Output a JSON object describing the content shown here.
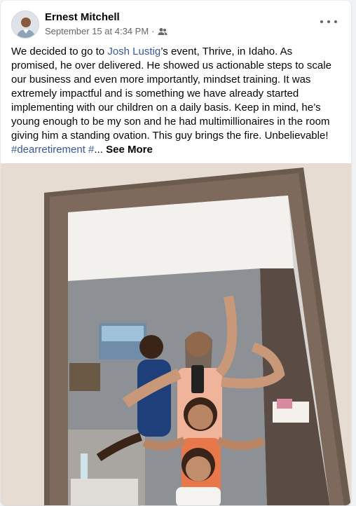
{
  "post": {
    "author": "Ernest Mitchell",
    "timestamp": "September 15 at 4:34 PM",
    "separator": "·",
    "audience_icon": "friends-icon",
    "more_icon": "more-options-icon",
    "text_intro": "We decided to go to ",
    "mention": "Josh Lustig",
    "text_body": "’s event, Thrive, in Idaho. As promised, he over delivered.  He showed us actionable steps to scale our business and even more importantly, mindset training. It was extremely impactful and is something we have already started implementing with our children on a daily basis. Keep in mind, he’s young enough to be my son and he had multimillionaires in the room giving him a standing ovation. This guy brings the fire. Unbelievable! ",
    "hashtag": "#dearretirement #",
    "ellipsis": "...",
    "see_more": "See More",
    "photo_description_icon": "post-photo"
  },
  "colors": {
    "link": "#385898",
    "meta": "#65676b",
    "text": "#050505"
  }
}
